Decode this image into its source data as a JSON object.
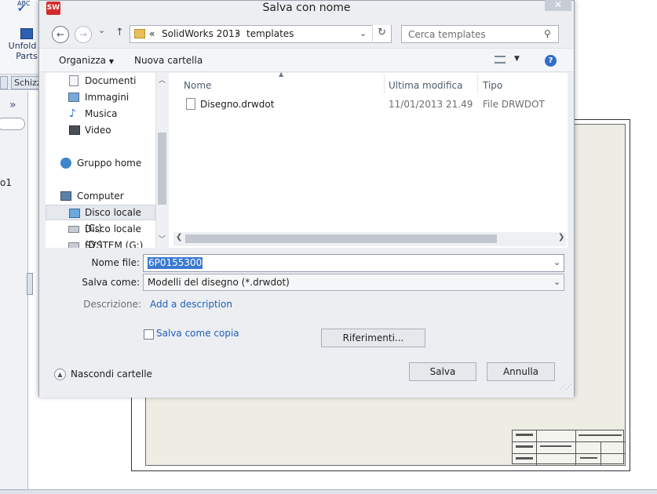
{
  "background_app": {
    "toolbar_label": "Unfold A Parts",
    "tab_label": "Schizz",
    "panel_chevron": "»",
    "panel_text": "o1"
  },
  "dialog": {
    "title": "Salva con nome",
    "app_icon": "SW",
    "close_glyph": "✕"
  },
  "navigation": {
    "back_glyph": "←",
    "forward_glyph": "→",
    "recent_glyph": "⌄",
    "up_glyph": "↑",
    "address": {
      "overflow": "«",
      "crumbs": [
        "SolidWorks 2013",
        "templates"
      ],
      "separator": "▸"
    },
    "refresh_glyph": "↻",
    "search_placeholder": "Cerca templates",
    "search_glyph": "⚲"
  },
  "commands": {
    "organize": "Organizza",
    "new_folder": "Nuova cartella",
    "help_glyph": "?"
  },
  "sidebar": {
    "items": [
      {
        "label": "Documenti",
        "icon": "documents-icon"
      },
      {
        "label": "Immagini",
        "icon": "pictures-icon"
      },
      {
        "label": "Musica",
        "icon": "music-icon"
      },
      {
        "label": "Video",
        "icon": "video-icon"
      },
      {
        "label": "Gruppo home",
        "icon": "homegroup-icon"
      },
      {
        "label": "Computer",
        "icon": "computer-icon"
      },
      {
        "label": "Disco locale (C:)",
        "icon": "drive-c-icon",
        "selected": true
      },
      {
        "label": "Disco locale (D:)",
        "icon": "drive-d-icon"
      },
      {
        "label": "SYSTEM (G:)",
        "icon": "drive-g-icon"
      }
    ]
  },
  "file_list": {
    "columns": [
      "Nome",
      "Ultima modifica",
      "Tipo"
    ],
    "rows": [
      {
        "name": "Disegno.drwdot",
        "modified": "11/01/2013 21.49",
        "type": "File DRWDOT"
      }
    ]
  },
  "form": {
    "filename_label": "Nome file:",
    "filename_value": "6P0155300",
    "savetype_label": "Salva come:",
    "savetype_value": "Modelli del disegno (*.drwdot)",
    "description_label": "Descrizione:",
    "description_link": "Add a description",
    "copy_label": "Salva come copia",
    "references_button": "Riferimenti...",
    "hide_folders": "Nascondi cartelle",
    "save_button": "Salva",
    "cancel_button": "Annulla"
  },
  "colors": {
    "accent": "#3a79d1",
    "link": "#1f5fb8",
    "selection_bg": "#e5e8ec"
  }
}
